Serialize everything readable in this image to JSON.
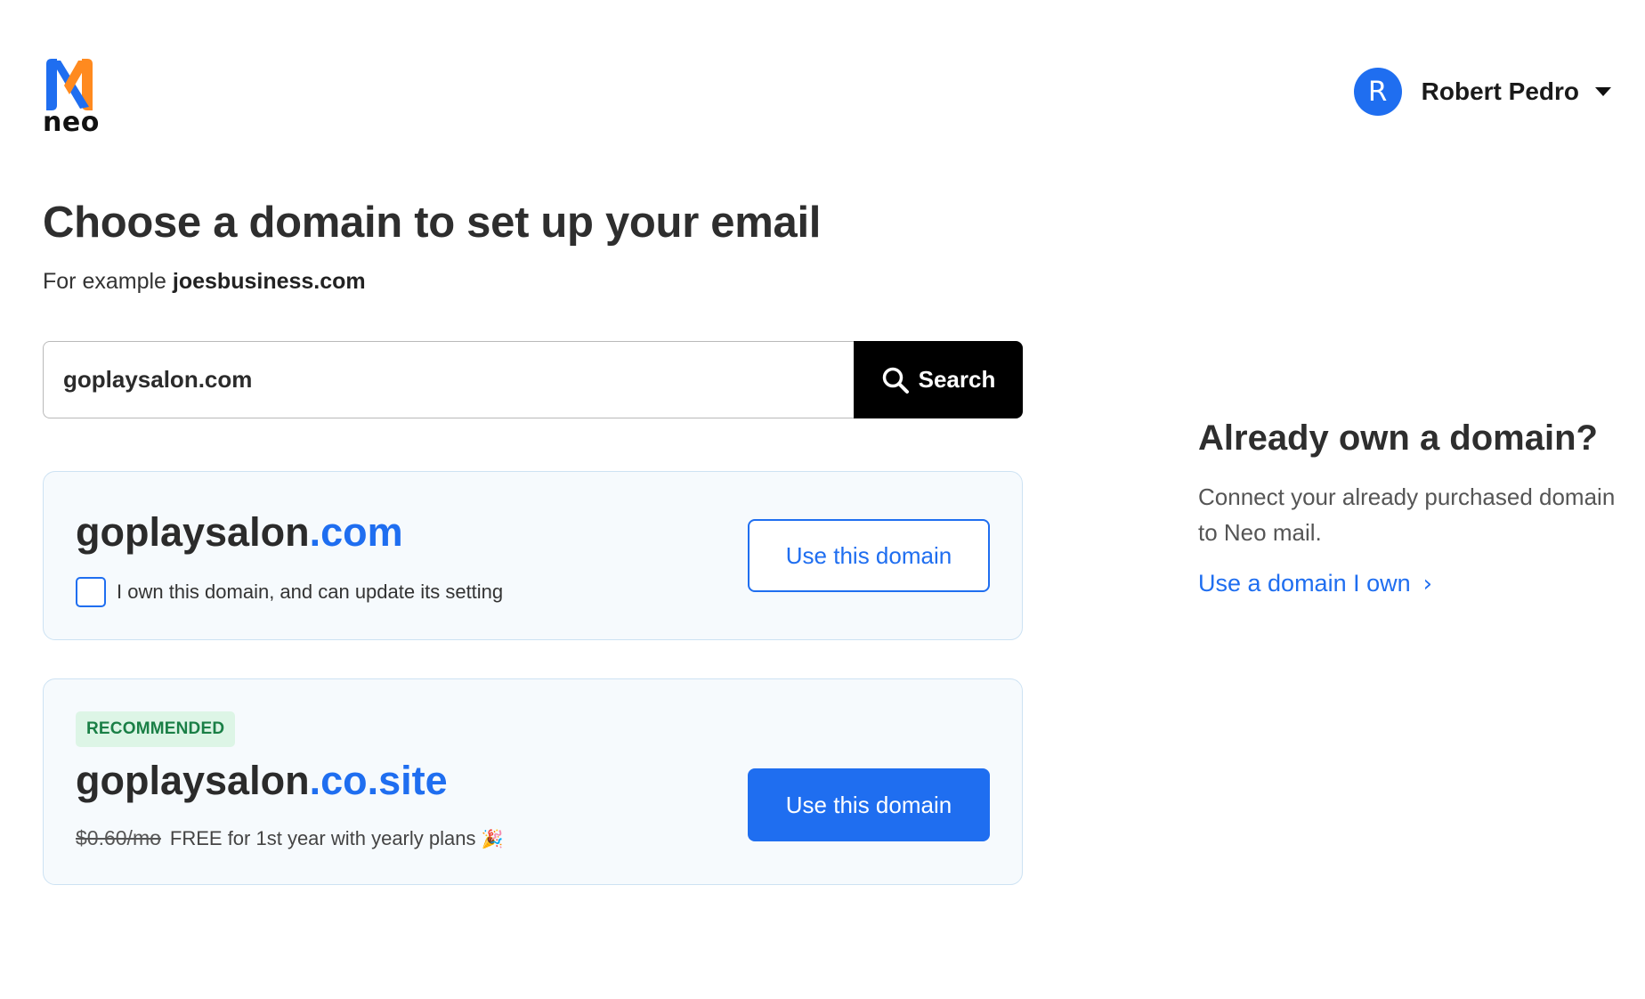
{
  "brand": {
    "name": "neo",
    "colors": {
      "orange": "#ff8a1f",
      "blue": "#1f6ef0"
    }
  },
  "user": {
    "initial": "R",
    "name": "Robert Pedro",
    "avatar_color": "#1f6ef0"
  },
  "page": {
    "title": "Choose a domain to set up your email",
    "example_prefix": "For example",
    "example_domain": "joesbusiness.com"
  },
  "search": {
    "value": "goplaysalon.com",
    "button_label": "Search"
  },
  "results": [
    {
      "name": "goplaysalon",
      "tld": ".com",
      "checkbox_label": "I own this domain, and can update its setting",
      "button_label": "Use this domain"
    },
    {
      "badge": "RECOMMENDED",
      "name": "goplaysalon",
      "tld": ".co.site",
      "old_price": "$0.60/mo",
      "offer": "FREE for 1st year with yearly plans",
      "offer_emoji": "🎉",
      "button_label": "Use this domain"
    }
  ],
  "sidebar": {
    "title": "Already own a domain?",
    "description": "Connect your already purchased domain to Neo mail.",
    "link_label": "Use a domain I own",
    "link_icon": "chevron-right-icon"
  },
  "colors": {
    "accent": "#1f6ef0",
    "badge_bg": "#ddf5e6",
    "badge_text": "#1a7f46",
    "card_bg": "#f6fafd",
    "card_border": "#cde2f3"
  }
}
